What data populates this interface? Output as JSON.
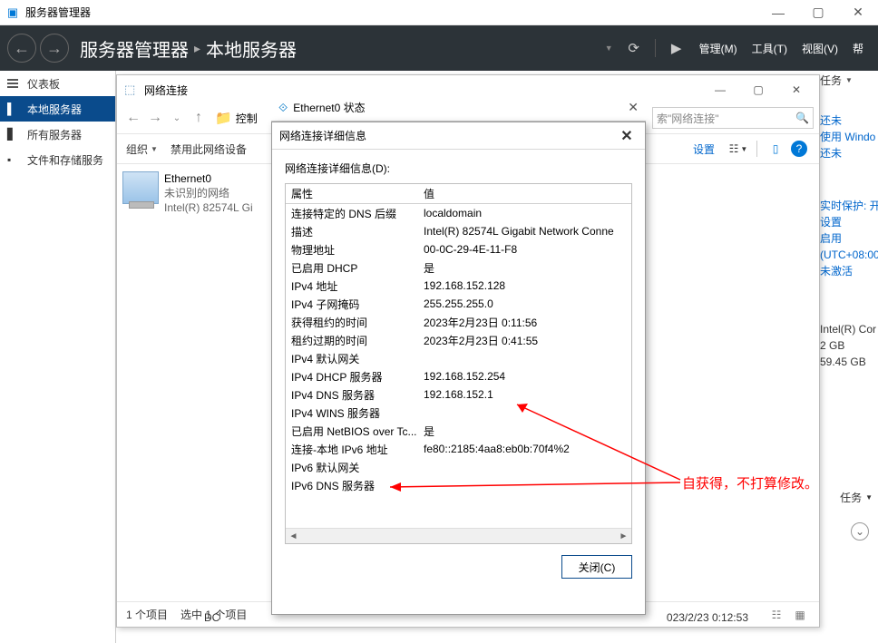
{
  "main_window": {
    "title": "服务器管理器"
  },
  "header": {
    "breadcrumb1": "服务器管理器",
    "breadcrumb2": "本地服务器",
    "menu_manage": "管理(M)",
    "menu_tools": "工具(T)",
    "menu_view": "视图(V)",
    "menu_help": "帮"
  },
  "sidebar": {
    "dashboard": "仪表板",
    "local_server": "本地服务器",
    "all_servers": "所有服务器",
    "file_storage": "文件和存储服务"
  },
  "explorer": {
    "title": "网络连接",
    "addr": "控制",
    "search_placeholder": "索\"网络连接\"",
    "toolbar": {
      "organize": "组织",
      "disable": "禁用此网络设备",
      "settings": "设置"
    },
    "item": {
      "name": "Ethernet0",
      "status": "未识别的网络",
      "adapter": "Intel(R) 82574L Gi"
    },
    "status_count": "1 个项目",
    "status_sel": "选中 1 个项目"
  },
  "status_dialog": {
    "title": "Ethernet0 状态"
  },
  "details_dialog": {
    "title": "网络连接详细信息",
    "label": "网络连接详细信息(D):",
    "col_prop": "属性",
    "col_val": "值",
    "rows": [
      {
        "p": "连接特定的 DNS 后缀",
        "v": "localdomain"
      },
      {
        "p": "描述",
        "v": "Intel(R) 82574L Gigabit Network Conne"
      },
      {
        "p": "物理地址",
        "v": "00-0C-29-4E-11-F8"
      },
      {
        "p": "已启用 DHCP",
        "v": "是"
      },
      {
        "p": "IPv4 地址",
        "v": "192.168.152.128"
      },
      {
        "p": "IPv4 子网掩码",
        "v": "255.255.255.0"
      },
      {
        "p": "获得租约的时间",
        "v": "2023年2月23日 0:11:56"
      },
      {
        "p": "租约过期的时间",
        "v": "2023年2月23日 0:41:55"
      },
      {
        "p": "IPv4 默认网关",
        "v": ""
      },
      {
        "p": "IPv4 DHCP 服务器",
        "v": "192.168.152.254"
      },
      {
        "p": "IPv4 DNS 服务器",
        "v": "192.168.152.1"
      },
      {
        "p": "IPv4 WINS 服务器",
        "v": ""
      },
      {
        "p": "已启用 NetBIOS over Tc...",
        "v": "是"
      },
      {
        "p": "连接-本地 IPv6 地址",
        "v": "fe80::2185:4aa8:eb0b:70f4%2"
      },
      {
        "p": "IPv6 默认网关",
        "v": ""
      },
      {
        "p": "IPv6 DNS 服务器",
        "v": ""
      }
    ],
    "close_btn": "关闭(C)"
  },
  "annotation": {
    "text": "自获得，不打算修改。"
  },
  "right_panel": {
    "tasks": "任务",
    "l1": "还未",
    "l2": "使用 Windo",
    "l3": "还未",
    "rt1": "实时保护: 开",
    "rt2": "设置",
    "rt3": "启用",
    "tz": "(UTC+08:00",
    "na": "未激活",
    "cpu": "Intel(R) Cor",
    "ram": "2 GB",
    "disk": "59.45 GB"
  },
  "bottom": {
    "dc": "DC",
    "ts": "023/2/23 0:12:53"
  }
}
